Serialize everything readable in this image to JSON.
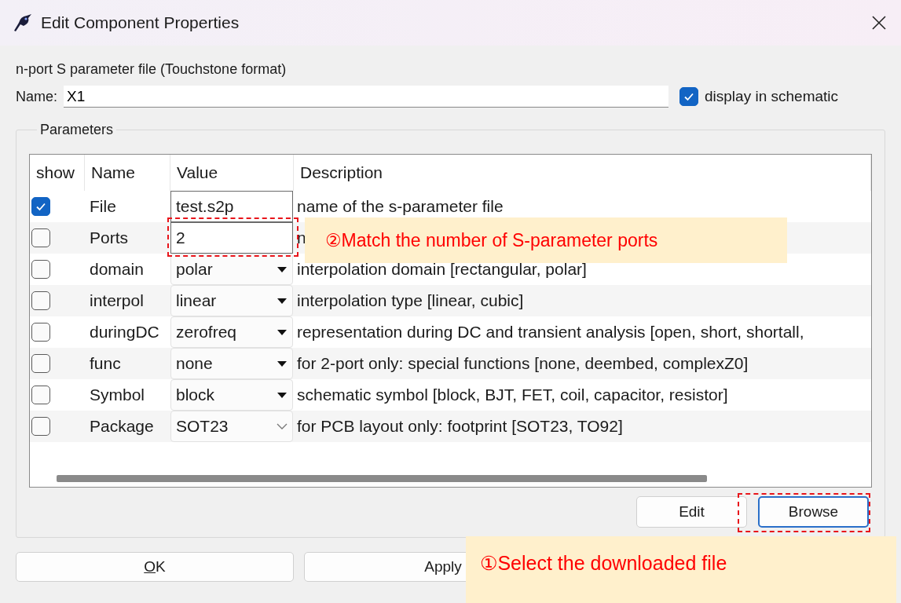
{
  "window": {
    "title": "Edit Component Properties"
  },
  "description": "n-port S parameter file (Touchstone format)",
  "name_field": {
    "label": "Name:",
    "value": "X1"
  },
  "display_in_schematic": {
    "label": "display in schematic",
    "checked": true
  },
  "parameters": {
    "title": "Parameters",
    "columns": [
      "show",
      "Name",
      "Value",
      "Description"
    ],
    "rows": [
      {
        "show": true,
        "name": "File",
        "kind": "text",
        "value": "test.s2p",
        "description": "name of the s-parameter file"
      },
      {
        "show": false,
        "name": "Ports",
        "kind": "text",
        "value": "2",
        "description": "n"
      },
      {
        "show": false,
        "name": "domain",
        "kind": "dropdown",
        "value": "polar",
        "description": "interpolation domain [rectangular, polar]"
      },
      {
        "show": false,
        "name": "interpol",
        "kind": "dropdown",
        "value": "linear",
        "description": "interpolation type [linear, cubic]"
      },
      {
        "show": false,
        "name": "duringDC",
        "kind": "dropdown",
        "value": "zerofreq",
        "description": "representation during DC and transient analysis [open, short, shortall,"
      },
      {
        "show": false,
        "name": "func",
        "kind": "dropdown",
        "value": "none",
        "description": "for 2-port only: special functions [none, deembed, complexZ0]"
      },
      {
        "show": false,
        "name": "Symbol",
        "kind": "dropdown",
        "value": "block",
        "description": "schematic symbol [block, BJT, FET, coil, capacitor, resistor]"
      },
      {
        "show": false,
        "name": "Package",
        "kind": "combo",
        "value": "SOT23",
        "description": "for PCB layout only: footprint [SOT23, TO92]"
      }
    ],
    "buttons": [
      {
        "label": "Edit",
        "focused": false
      },
      {
        "label": "Browse",
        "focused": true
      }
    ]
  },
  "dialog_buttons": [
    {
      "label": "OK",
      "mnemonic_underlined": true
    },
    {
      "label": "Apply",
      "mnemonic_underlined": false
    }
  ],
  "annotations": [
    {
      "kind": "field_note",
      "text": "②Match the number of S-parameter ports"
    },
    {
      "kind": "button_note",
      "text": "①Select the downloaded file"
    }
  ]
}
